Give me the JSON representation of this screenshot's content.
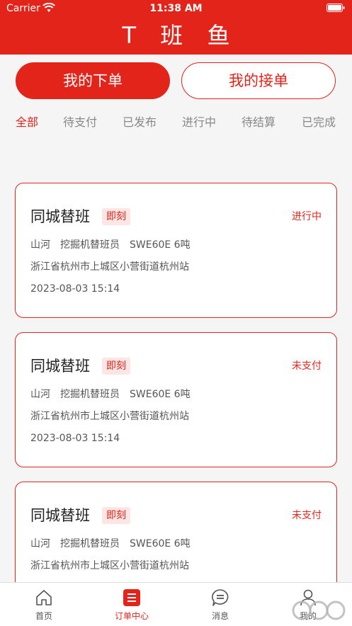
{
  "status_bar": {
    "carrier": "Carrier",
    "time": "11:38 AM"
  },
  "header": {
    "title": "T 班 鱼"
  },
  "segments": {
    "mine": "我的下单",
    "accepted": "我的接单"
  },
  "tabs": [
    "全部",
    "待支付",
    "已发布",
    "进行中",
    "待结算",
    "已完成"
  ],
  "orders": [
    {
      "title": "同城替班",
      "tag": "即刻",
      "status": "进行中",
      "place": "山河",
      "role": "挖掘机替班员",
      "machine": "SWE60E 6吨",
      "address": "浙江省杭州市上城区小营街道杭州站",
      "time": "2023-08-03 15:14"
    },
    {
      "title": "同城替班",
      "tag": "即刻",
      "status": "未支付",
      "place": "山河",
      "role": "挖掘机替班员",
      "machine": "SWE60E 6吨",
      "address": "浙江省杭州市上城区小营街道杭州站",
      "time": "2023-08-03 15:14"
    },
    {
      "title": "同城替班",
      "tag": "即刻",
      "status": "未支付",
      "place": "山河",
      "role": "挖掘机替班员",
      "machine": "SWE60E 6吨",
      "address": "浙江省杭州市上城区小营街道杭州站",
      "time": ""
    }
  ],
  "tabbar": [
    "首页",
    "订单中心",
    "消息",
    "我的"
  ],
  "colors": {
    "accent": "#e3241b",
    "background": "#f5f5f5"
  }
}
